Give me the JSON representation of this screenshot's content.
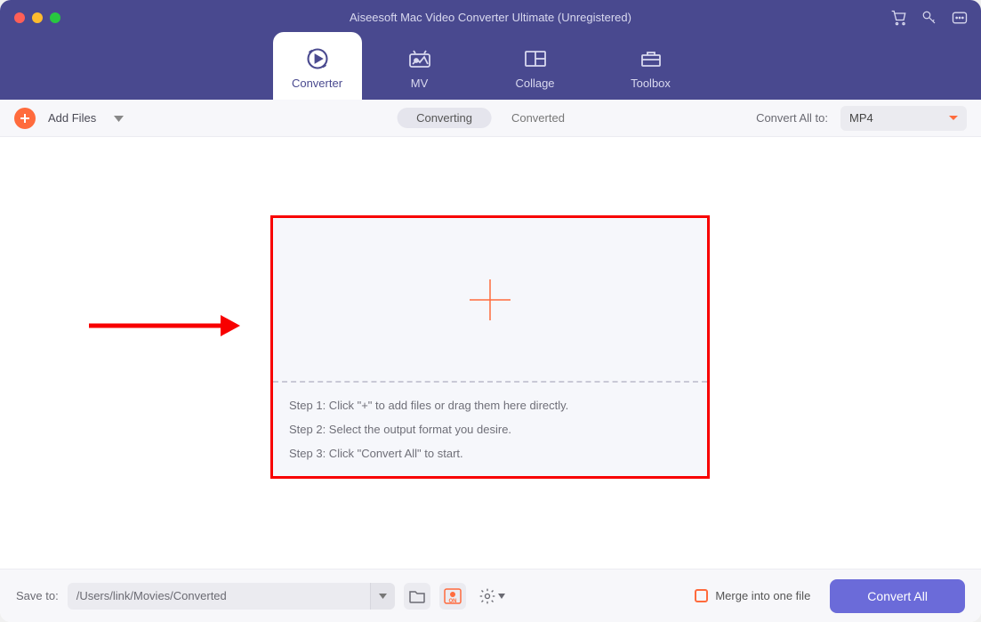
{
  "window": {
    "title": "Aiseesoft Mac Video Converter Ultimate (Unregistered)"
  },
  "tabs": [
    {
      "label": "Converter"
    },
    {
      "label": "MV"
    },
    {
      "label": "Collage"
    },
    {
      "label": "Toolbox"
    }
  ],
  "toolbar": {
    "add_files_label": "Add Files",
    "segments": {
      "converting": "Converting",
      "converted": "Converted"
    },
    "convert_all_to_label": "Convert All to:",
    "format_selected": "MP4"
  },
  "dropzone": {
    "step1": "Step 1: Click \"+\" to add files or drag them here directly.",
    "step2": "Step 2: Select the output format you desire.",
    "step3": "Step 3: Click \"Convert All\" to start."
  },
  "footer": {
    "save_to_label": "Save to:",
    "path": "/Users/link/Movies/Converted",
    "merge_label": "Merge into one file",
    "convert_all_button": "Convert All"
  },
  "colors": {
    "header_bg": "#49498f",
    "accent_orange": "#ff6b3d",
    "primary_button": "#6b6bd9",
    "annotation_red": "#f80000"
  }
}
